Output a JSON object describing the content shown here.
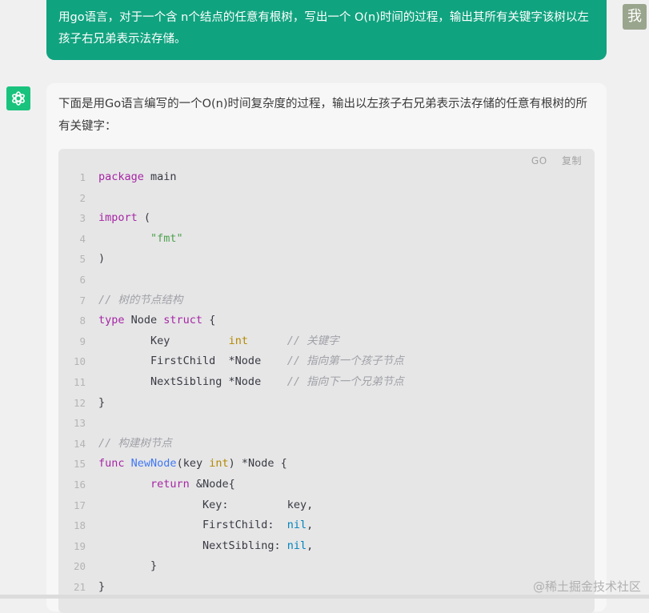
{
  "user_message": {
    "text": "用go语言，对于一个含 n个结点的任意有根树，写出一个 O(n)时间的过程，输出其所有关键字该树以左孩子右兄弟表示法存储。",
    "avatar_label": "我"
  },
  "assistant": {
    "intro": "下面是用Go语言编写的一个O(n)时间复杂度的过程，输出以左孩子右兄弟表示法存储的任意有根树的所有关键字：",
    "code": {
      "language": "GO",
      "copy_label": "复制",
      "lines": [
        {
          "n": "1",
          "t": "package main"
        },
        {
          "n": "2",
          "t": ""
        },
        {
          "n": "3",
          "t": "import ("
        },
        {
          "n": "4",
          "t": "        \"fmt\""
        },
        {
          "n": "5",
          "t": ")"
        },
        {
          "n": "6",
          "t": ""
        },
        {
          "n": "7",
          "t": "// 树的节点结构"
        },
        {
          "n": "8",
          "t": "type Node struct {"
        },
        {
          "n": "9",
          "t": "        Key         int      // 关键字"
        },
        {
          "n": "10",
          "t": "        FirstChild  *Node    // 指向第一个孩子节点"
        },
        {
          "n": "11",
          "t": "        NextSibling *Node    // 指向下一个兄弟节点"
        },
        {
          "n": "12",
          "t": "}"
        },
        {
          "n": "13",
          "t": ""
        },
        {
          "n": "14",
          "t": "// 构建树节点"
        },
        {
          "n": "15",
          "t": "func NewNode(key int) *Node {"
        },
        {
          "n": "16",
          "t": "        return &Node{"
        },
        {
          "n": "17",
          "t": "                Key:         key,"
        },
        {
          "n": "18",
          "t": "                FirstChild:  nil,"
        },
        {
          "n": "19",
          "t": "                NextSibling: nil,"
        },
        {
          "n": "20",
          "t": "        }"
        },
        {
          "n": "21",
          "t": "}"
        }
      ]
    }
  },
  "watermark": "@稀土掘金技术社区",
  "colors": {
    "user_bubble": "#10a37f",
    "bot_avatar": "#19c37d",
    "keyword": "#a626a4",
    "string": "#50a14f",
    "comment": "#a0a1a7",
    "type": "#b58900",
    "function": "#4078f2",
    "nil": "#0184bc"
  }
}
